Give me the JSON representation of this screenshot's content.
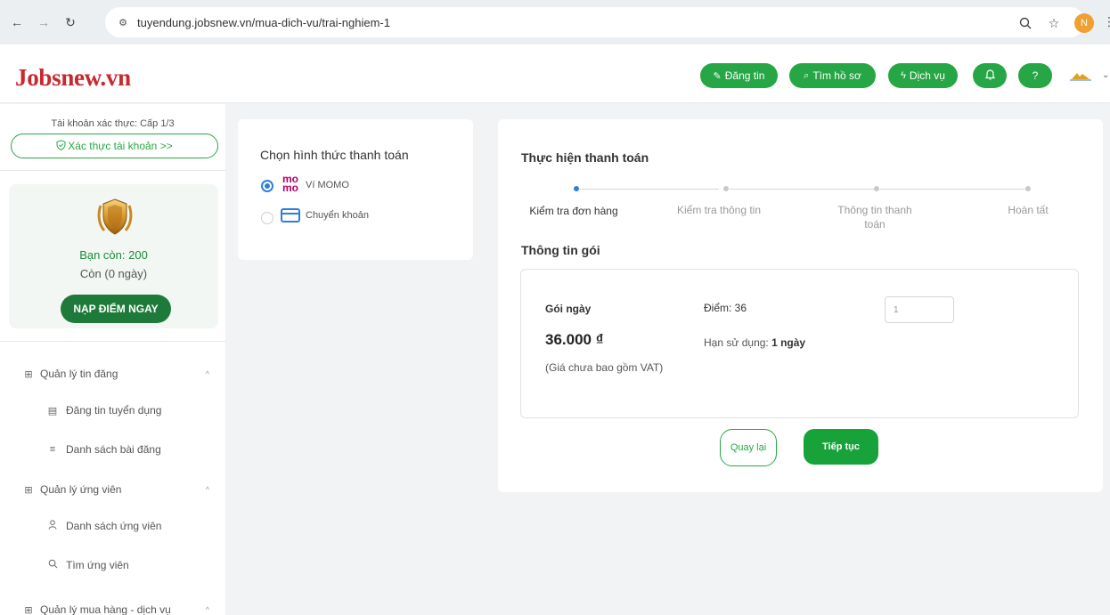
{
  "browser": {
    "url": "tuyendung.jobsnew.vn/mua-dich-vu/trai-nghiem-1",
    "profile_initial": "N"
  },
  "header": {
    "logo": "Jobsnew.vn",
    "post_btn": "Đăng tin",
    "search_cv_btn": "Tìm hồ sơ",
    "services_btn": "Dịch vụ",
    "help_btn": "?"
  },
  "sidebar": {
    "account_level": "Tài khoản xác thực: Cấp 1/3",
    "verify_btn": "Xác thực tài khoản >>",
    "balance": "Bạn còn: 200",
    "days": "Còn (0 ngày)",
    "topup_btn": "NẠP ĐIỂM NGAY",
    "menu": [
      {
        "label": "Quản lý tin đăng"
      },
      {
        "label": "Đăng tin tuyển dụng"
      },
      {
        "label": "Danh sách bài đăng"
      },
      {
        "label": "Quản lý ứng viên"
      },
      {
        "label": "Danh sách ứng viên"
      },
      {
        "label": "Tìm ứng viên"
      },
      {
        "label": "Quản lý mua hàng - dịch vụ"
      }
    ]
  },
  "payment_method": {
    "title": "Chọn hình thức thanh toán",
    "options": [
      {
        "label": "Ví MOMO",
        "selected": true
      },
      {
        "label": "Chuyển khoản",
        "selected": false
      }
    ]
  },
  "payment": {
    "title": "Thực hiện thanh toán",
    "steps": [
      {
        "label": "Kiểm tra đơn hàng",
        "active": true
      },
      {
        "label": "Kiểm tra thông tin",
        "active": false
      },
      {
        "label": "Thông tin thanh toán",
        "active": false
      },
      {
        "label": "Hoàn tất",
        "active": false
      }
    ],
    "package_title": "Thông tin gói",
    "package": {
      "name": "Gói ngày",
      "price": "36.000 ₫",
      "vat_note": "(Giá chưa bao gồm VAT)",
      "points": "Điểm: 36",
      "validity_label": "Hạn sử dụng:",
      "validity_value": "1 ngày",
      "quantity": "1"
    },
    "back_btn": "Quay lại",
    "next_btn": "Tiếp tục"
  },
  "colors": {
    "brand_red": "#c8282e",
    "primary_green": "#26a645",
    "step_blue": "#2f7fd8"
  }
}
